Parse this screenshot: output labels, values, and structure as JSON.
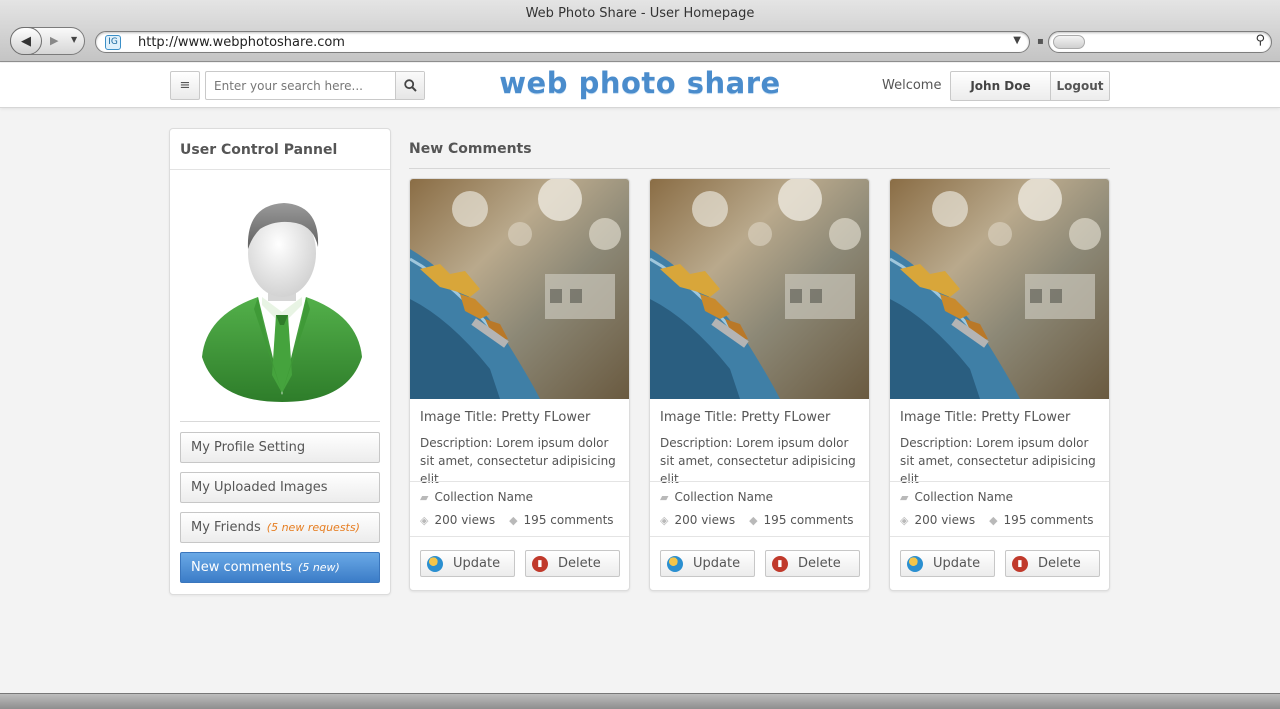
{
  "browser": {
    "window_title": "Web Photo Share - User Homepage",
    "url": "http://www.webphotoshare.com",
    "favicon_text": "IG"
  },
  "header": {
    "search_placeholder": "Enter your search here...",
    "logo_text": "web photo share",
    "welcome_text": "Welcome",
    "user_name": "John Doe",
    "logout_label": "Logout",
    "brand_color": "#4a8ccc"
  },
  "sidebar": {
    "title": "User Control Pannel",
    "items": [
      {
        "label": "My Profile Setting",
        "note": ""
      },
      {
        "label": "My Uploaded Images",
        "note": ""
      },
      {
        "label": "My Friends",
        "note": "(5 new requests)"
      },
      {
        "label": "New comments",
        "note": "(5 new)",
        "active": true
      }
    ]
  },
  "main": {
    "section_title": "New Comments",
    "cards": [
      {
        "title": "Image Title: Pretty FLower",
        "description": "Description: Lorem ipsum dolor sit amet, consectetur adipisicing elit",
        "collection": "Collection Name",
        "views": "200 views",
        "comments": "195 comments",
        "update_label": "Update",
        "delete_label": "Delete"
      },
      {
        "title": "Image Title: Pretty FLower",
        "description": "Description: Lorem ipsum dolor sit amet, consectetur adipisicing elit",
        "collection": "Collection Name",
        "views": "200 views",
        "comments": "195 comments",
        "update_label": "Update",
        "delete_label": "Delete"
      },
      {
        "title": "Image Title: Pretty FLower",
        "description": "Description: Lorem ipsum dolor sit amet, consectetur adipisicing elit",
        "collection": "Collection Name",
        "views": "200 views",
        "comments": "195 comments",
        "update_label": "Update",
        "delete_label": "Delete"
      }
    ]
  }
}
